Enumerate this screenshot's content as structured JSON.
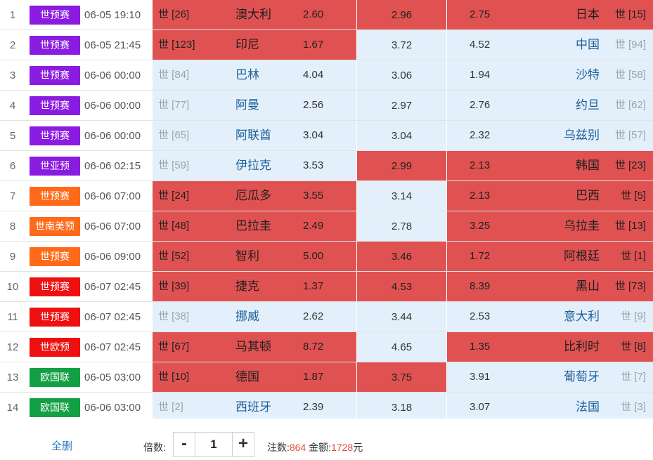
{
  "colors": {
    "selected_bg": "#e05252",
    "unselected_bg": "#e3f0fb",
    "league_purple": "#8a1be0",
    "league_orange": "#ff6a1a",
    "league_red": "#ee1010",
    "league_green": "#13a045",
    "accent_link": "#2a77c9",
    "summary_num": "#e0503c"
  },
  "matches": [
    {
      "no": "1",
      "league": "世预赛",
      "league_color": "#8a1be0",
      "time": "06-05 19:10",
      "home_rank": "世 [26]",
      "home": "澳大利",
      "home_odd": "2.60",
      "draw_odd": "2.96",
      "away_odd": "2.75",
      "away": "日本",
      "away_rank": "世 [15]",
      "home_sel": true,
      "draw_sel": true,
      "away_sel": true
    },
    {
      "no": "2",
      "league": "世预赛",
      "league_color": "#8a1be0",
      "time": "06-05 21:45",
      "home_rank": "世 [123]",
      "home": "印尼",
      "home_odd": "1.67",
      "draw_odd": "3.72",
      "away_odd": "4.52",
      "away": "中国",
      "away_rank": "世 [94]",
      "home_sel": true,
      "draw_sel": false,
      "away_sel": false
    },
    {
      "no": "3",
      "league": "世预赛",
      "league_color": "#8a1be0",
      "time": "06-06 00:00",
      "home_rank": "世 [84]",
      "home": "巴林",
      "home_odd": "4.04",
      "draw_odd": "3.06",
      "away_odd": "1.94",
      "away": "沙特",
      "away_rank": "世 [58]",
      "home_sel": false,
      "draw_sel": false,
      "away_sel": false
    },
    {
      "no": "4",
      "league": "世预赛",
      "league_color": "#8a1be0",
      "time": "06-06 00:00",
      "home_rank": "世 [77]",
      "home": "阿曼",
      "home_odd": "2.56",
      "draw_odd": "2.97",
      "away_odd": "2.76",
      "away": "约旦",
      "away_rank": "世 [62]",
      "home_sel": false,
      "draw_sel": false,
      "away_sel": false
    },
    {
      "no": "5",
      "league": "世预赛",
      "league_color": "#8a1be0",
      "time": "06-06 00:00",
      "home_rank": "世 [65]",
      "home": "阿联酋",
      "home_odd": "3.04",
      "draw_odd": "3.04",
      "away_odd": "2.32",
      "away": "乌兹别",
      "away_rank": "世 [57]",
      "home_sel": false,
      "draw_sel": false,
      "away_sel": false
    },
    {
      "no": "6",
      "league": "世亚预",
      "league_color": "#8a1be0",
      "time": "06-06 02:15",
      "home_rank": "世 [59]",
      "home": "伊拉克",
      "home_odd": "3.53",
      "draw_odd": "2.99",
      "away_odd": "2.13",
      "away": "韩国",
      "away_rank": "世 [23]",
      "home_sel": false,
      "draw_sel": true,
      "away_sel": true
    },
    {
      "no": "7",
      "league": "世预赛",
      "league_color": "#ff6a1a",
      "time": "06-06 07:00",
      "home_rank": "世 [24]",
      "home": "厄瓜多",
      "home_odd": "3.55",
      "draw_odd": "3.14",
      "away_odd": "2.13",
      "away": "巴西",
      "away_rank": "世 [5]",
      "home_sel": true,
      "draw_sel": false,
      "away_sel": true
    },
    {
      "no": "8",
      "league": "世南美预",
      "league_color": "#ff6a1a",
      "time": "06-06 07:00",
      "home_rank": "世 [48]",
      "home": "巴拉圭",
      "home_odd": "2.49",
      "draw_odd": "2.78",
      "away_odd": "3.25",
      "away": "乌拉圭",
      "away_rank": "世 [13]",
      "home_sel": true,
      "draw_sel": false,
      "away_sel": true
    },
    {
      "no": "9",
      "league": "世预赛",
      "league_color": "#ff6a1a",
      "time": "06-06 09:00",
      "home_rank": "世 [52]",
      "home": "智利",
      "home_odd": "5.00",
      "draw_odd": "3.46",
      "away_odd": "1.72",
      "away": "阿根廷",
      "away_rank": "世 [1]",
      "home_sel": true,
      "draw_sel": true,
      "away_sel": true
    },
    {
      "no": "10",
      "league": "世预赛",
      "league_color": "#ee1010",
      "time": "06-07 02:45",
      "home_rank": "世 [39]",
      "home": "捷克",
      "home_odd": "1.37",
      "draw_odd": "4.53",
      "away_odd": "8.39",
      "away": "黑山",
      "away_rank": "世 [73]",
      "home_sel": true,
      "draw_sel": true,
      "away_sel": true
    },
    {
      "no": "11",
      "league": "世预赛",
      "league_color": "#ee1010",
      "time": "06-07 02:45",
      "home_rank": "世 [38]",
      "home": "挪威",
      "home_odd": "2.62",
      "draw_odd": "3.44",
      "away_odd": "2.53",
      "away": "意大利",
      "away_rank": "世 [9]",
      "home_sel": false,
      "draw_sel": false,
      "away_sel": false
    },
    {
      "no": "12",
      "league": "世欧预",
      "league_color": "#ee1010",
      "time": "06-07 02:45",
      "home_rank": "世 [67]",
      "home": "马其顿",
      "home_odd": "8.72",
      "draw_odd": "4.65",
      "away_odd": "1.35",
      "away": "比利时",
      "away_rank": "世 [8]",
      "home_sel": true,
      "draw_sel": false,
      "away_sel": true
    },
    {
      "no": "13",
      "league": "欧国联",
      "league_color": "#13a045",
      "time": "06-05 03:00",
      "home_rank": "世 [10]",
      "home": "德国",
      "home_odd": "1.87",
      "draw_odd": "3.75",
      "away_odd": "3.91",
      "away": "葡萄牙",
      "away_rank": "世 [7]",
      "home_sel": true,
      "draw_sel": true,
      "away_sel": false
    },
    {
      "no": "14",
      "league": "欧国联",
      "league_color": "#13a045",
      "time": "06-06 03:00",
      "home_rank": "世 [2]",
      "home": "西班牙",
      "home_odd": "2.39",
      "draw_odd": "3.18",
      "away_odd": "3.07",
      "away": "法国",
      "away_rank": "世 [3]",
      "home_sel": false,
      "draw_sel": false,
      "away_sel": false
    }
  ],
  "footer": {
    "clear_label": "全删",
    "multiplier_label": "倍数:",
    "minus_label": "-",
    "plus_label": "+",
    "multiplier_value": "1",
    "bets_label": "注数:",
    "bets_value": "864",
    "amount_label": "金额:",
    "amount_value": "1728",
    "amount_unit": "元"
  }
}
